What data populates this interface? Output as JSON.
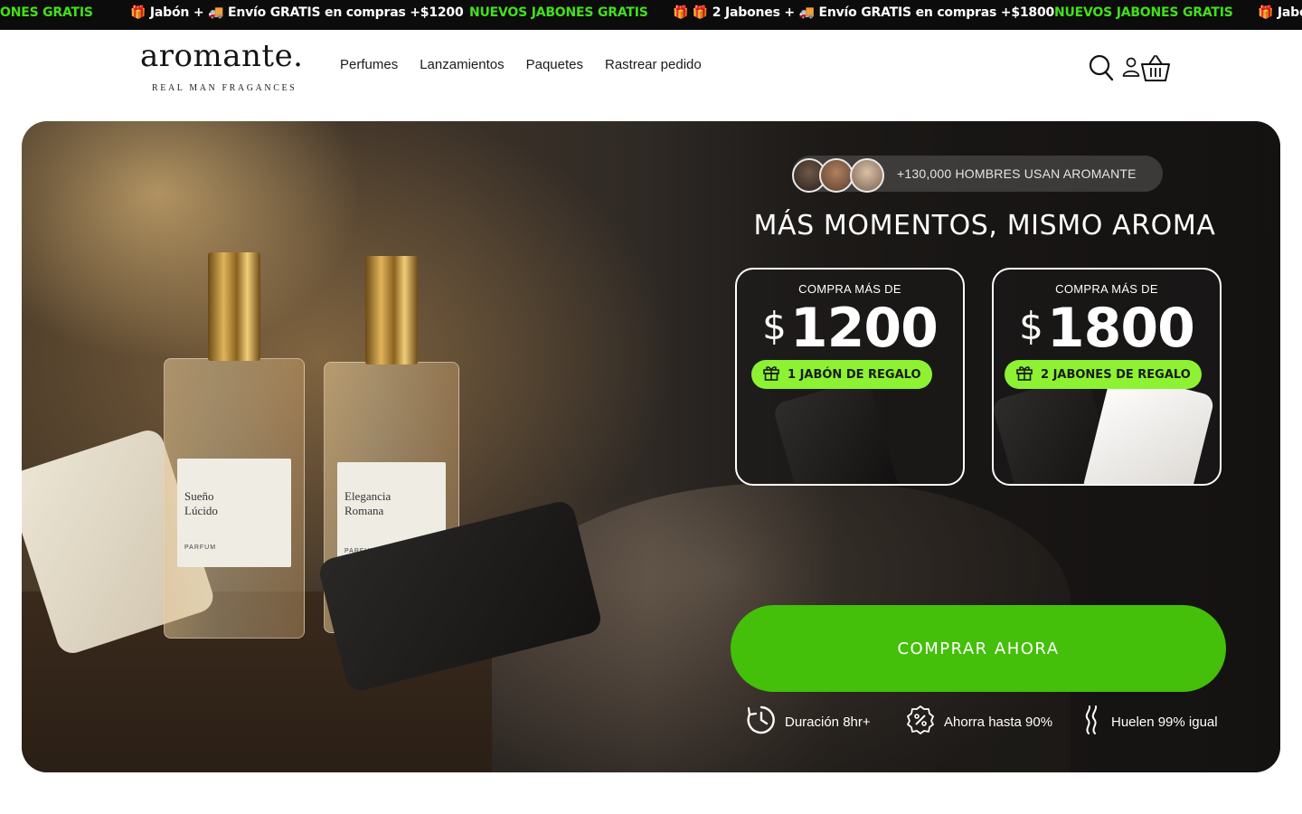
{
  "announcement_bar": {
    "items": [
      {
        "text": "ONES GRATIS",
        "style": "green"
      },
      {
        "text": "🎁 Jabón + 🚚 Envío GRATIS en compras +$1200",
        "style": "white"
      },
      {
        "text": "NUEVOS JABONES GRATIS",
        "style": "green"
      },
      {
        "text": "🎁 🎁 2 Jabones + 🚚 Envío GRATIS en compras +$1800",
        "style": "white"
      },
      {
        "text": "NUEVOS JABONES GRATIS",
        "style": "green"
      },
      {
        "text": "🎁 Jabo",
        "style": "white"
      }
    ]
  },
  "header": {
    "logo_word": "aromante.",
    "logo_tagline": "REAL MAN FRAGANCES",
    "nav": [
      "Perfumes",
      "Lanzamientos",
      "Paquetes",
      "Rastrear pedido"
    ],
    "icons": [
      "search-icon",
      "account-icon",
      "cart-icon"
    ]
  },
  "hero": {
    "social_proof": "+130,000 HOMBRES USAN AROMANTE",
    "title": "MÁS MOMENTOS, MISMO AROMA",
    "offers": [
      {
        "heading": "COMPRA MÁS DE",
        "currency": "$",
        "amount": "1200",
        "gift": "1 JABÓN DE REGALO"
      },
      {
        "heading": "COMPRA MÁS DE",
        "currency": "$",
        "amount": "1800",
        "gift": "2 JABONES DE REGALO"
      }
    ],
    "cta": "COMPRAR AHORA",
    "features": [
      {
        "icon": "clock-icon",
        "label": "Duración 8hr+"
      },
      {
        "icon": "percent-badge-icon",
        "label": "Ahorra hasta 90%"
      },
      {
        "icon": "scent-waves-icon",
        "label": "Huelen 99% igual"
      }
    ],
    "product_labels": [
      {
        "name_line1": "Sueño",
        "name_line2": "Lúcido",
        "type": "PARFUM"
      },
      {
        "name_line1": "Elegancia",
        "name_line2": "Romana",
        "type": "PARFUM"
      }
    ]
  },
  "colors": {
    "accent_green": "#44bf0a",
    "gift_green": "#8cf232",
    "marquee_green": "#42e01a",
    "announcement_bg": "#0c0c0c"
  }
}
